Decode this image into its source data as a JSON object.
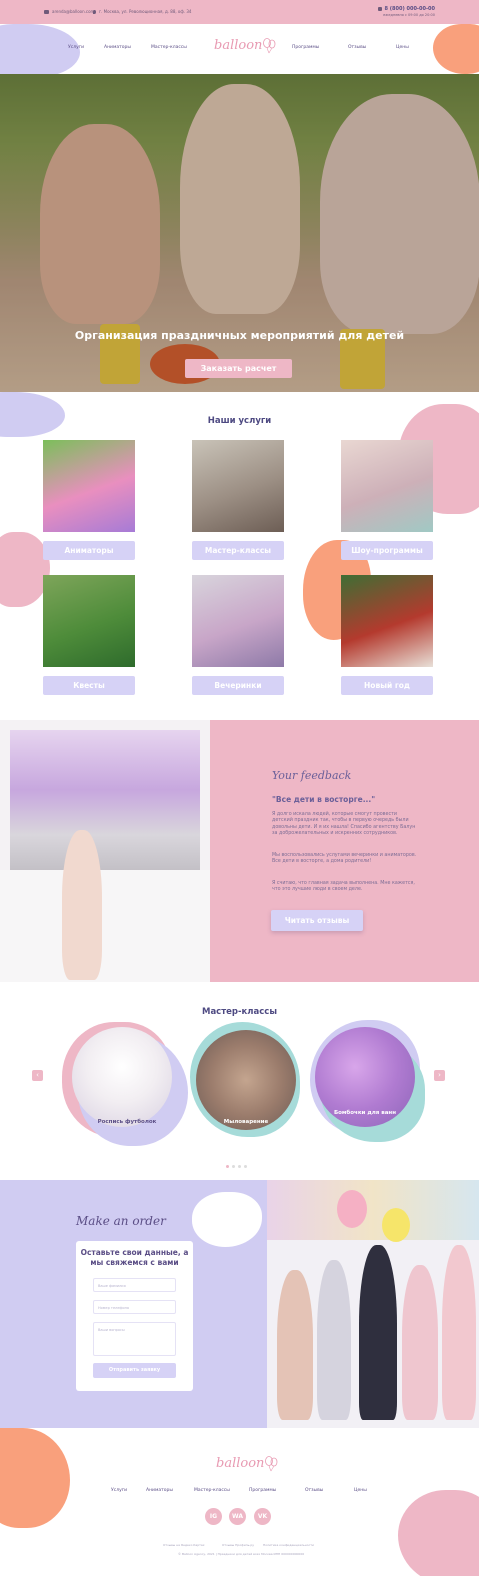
{
  "topbar": {
    "email": "arenda@balloon.com",
    "address": "г. Москва, ул. Революционная, д. 88, оф. 34",
    "phone": "8 (800) 000-00-00",
    "hours": "ежедневно с 09:00 до 20:00"
  },
  "nav": {
    "items": [
      "Услуги",
      "Аниматоры",
      "Мастер-классы",
      "Программы",
      "Отзывы",
      "Цены"
    ]
  },
  "logo": "balloon",
  "hero": {
    "title": "Организация праздничных мероприятий для детей",
    "button": "Заказать расчет"
  },
  "services": {
    "title": "Наши услуги",
    "items": [
      {
        "label": "Аниматоры"
      },
      {
        "label": "Мастер-классы"
      },
      {
        "label": "Шоу-программы"
      },
      {
        "label": "Квесты"
      },
      {
        "label": "Вечеринки"
      },
      {
        "label": "Новый год"
      }
    ]
  },
  "feedback": {
    "script": "Your feedback",
    "quote": "\"Все дети в восторге...\"",
    "p1": "Я долго искала людей, которые смогут провести детский праздник так, чтобы в первую очередь были довольны дети. И я их нашла! Спасибо агентству Балун за доброжелательных и искренних сотрудников.",
    "p2": "Мы воспользовались услугами вечеринки и аниматоров. Все дети в восторге, а дома родители!",
    "p3": "Я считаю, что главная задача выполнена. Мне кажется, что это лучшие люди в своем деле.",
    "button": "Читать отзывы"
  },
  "masters": {
    "title": "Мастер-классы",
    "items": [
      {
        "label": "Роспись футболок"
      },
      {
        "label": "Мыловарение"
      },
      {
        "label": "Бомбочки для ванн"
      }
    ],
    "prev": "‹",
    "next": "›"
  },
  "order": {
    "script": "Make an order",
    "title": "Оставьте свои данные, а мы свяжемся с вами",
    "name_placeholder": "Ваше фамилия",
    "phone_placeholder": "Номер телефона",
    "comment_placeholder": "Ваши вопросы",
    "button": "Отправить заявку"
  },
  "footer": {
    "nav": [
      "Услуги",
      "Аниматоры",
      "Мастер-классы",
      "Программы",
      "Отзывы",
      "Цены"
    ],
    "social": [
      "IG",
      "WA",
      "VK"
    ],
    "links": [
      "Отзывы на Яндекс.Картах",
      "Отзывы Профиль.ру",
      "Политика конфиденциальности"
    ],
    "copyright": "© Balloon Agency, 2021 | Праздники для детей всех Москва ИНН 000000000000"
  },
  "colors": {
    "pink": "#eeb7c6",
    "lavender": "#d0ccf2",
    "peach": "#f9a07c",
    "navy_text": "#4e4a82"
  }
}
